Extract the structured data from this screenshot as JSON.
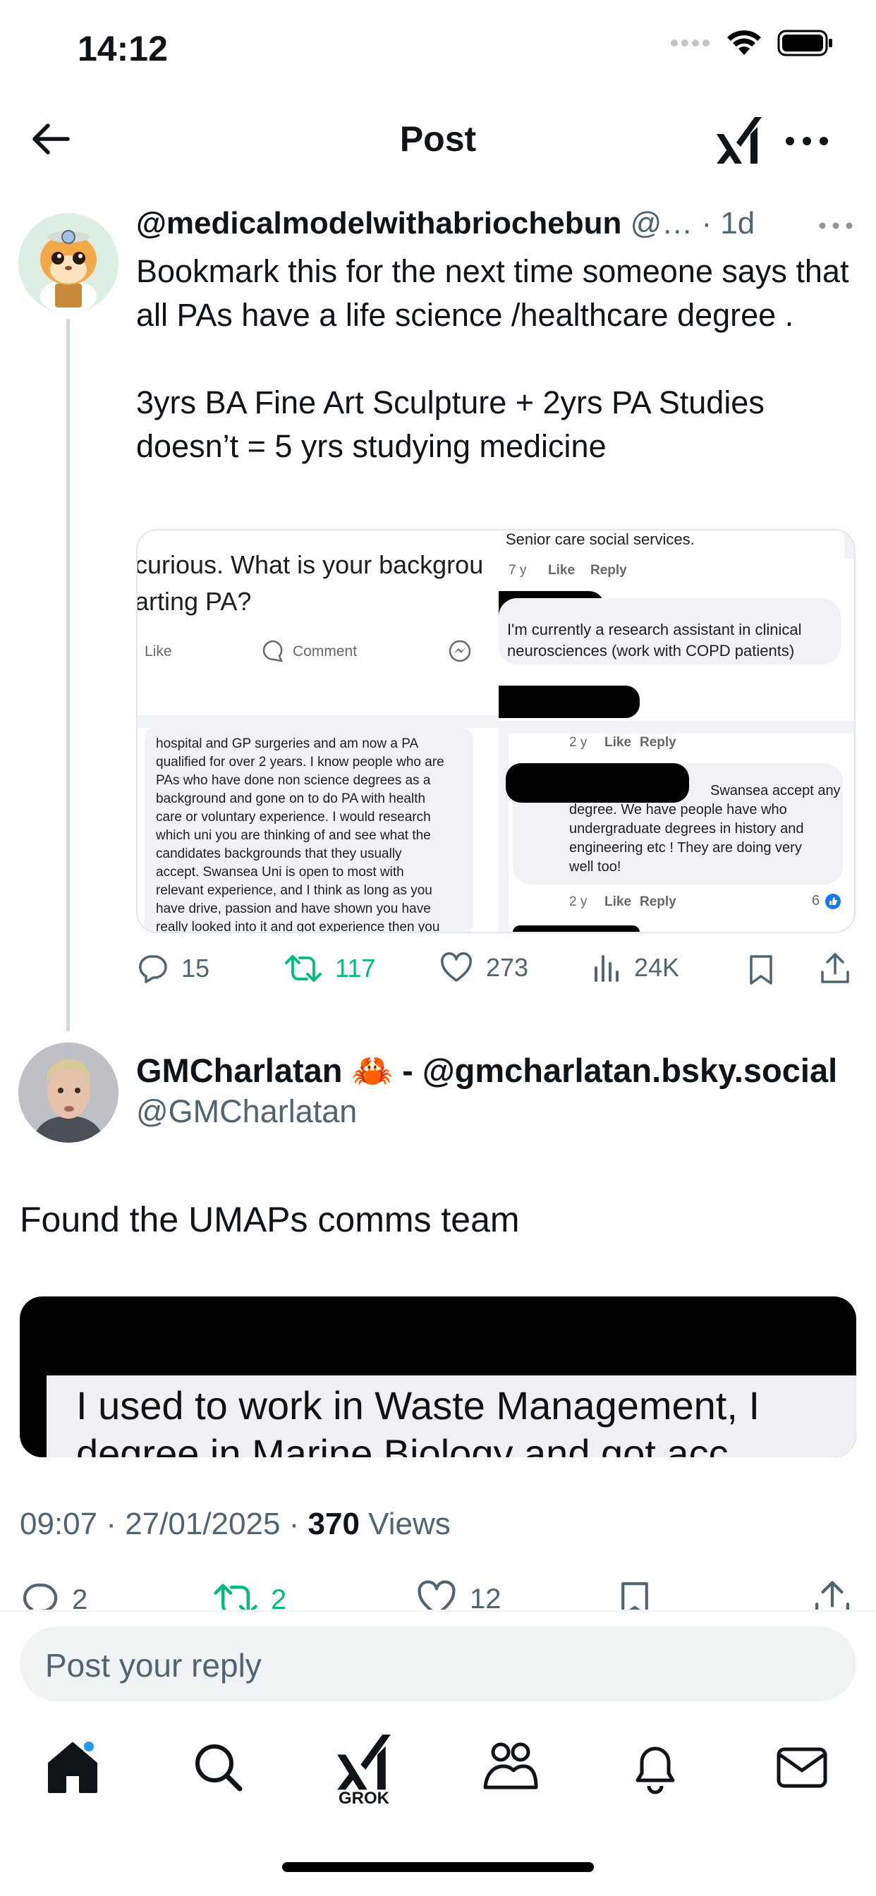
{
  "status_bar": {
    "time": "14:12"
  },
  "header": {
    "title": "Post"
  },
  "post1": {
    "display_name": "@medicalmodelwithabriochebun",
    "meta": " @… · 1d",
    "text_line1": "Bookmark this for the next time someone says that all PAs have a life science /healthcare degree .",
    "text_line2": "3yrs BA Fine Art Sculpture + 2yrs PA Studies doesn’t = 5 yrs studying medicine",
    "media": {
      "left_question": "curious. What is your backgrou",
      "left_question2": "arting PA?",
      "like": "Like",
      "comment": "Comment",
      "left_body": [
        "hospital and GP surgeries and am now a PA",
        "qualified for over 2 years. I know people who are",
        "PAs who have done non science degrees as a",
        "background and gone on to do PA with health",
        "care or voluntary experience. I would research",
        "which uni you are thinking of and see what the",
        "candidates backgrounds that they usually",
        "accept. Swansea Uni is open to most with",
        "relevant experience, and I think as long as you",
        "have drive, passion and have shown you have",
        "really looked into it and got experience then you"
      ],
      "right_top": "Senior care social services.",
      "right_age1": "7 y",
      "right_like": "Like",
      "right_reply": "Reply",
      "right_c2_1": "I'm currently a research assistant in clinical",
      "right_c2_2": "neurosciences (work with COPD patients)",
      "right_age2": "2 y",
      "right_c3": [
        "Swansea accept any",
        "degree. We have people have who",
        "undergraduate degrees in history and",
        "engineering etc ! They are doing very",
        "well too!"
      ],
      "right_reactions": "6"
    },
    "actions": {
      "replies": "15",
      "reposts": "117",
      "likes": "273",
      "views": "24K"
    }
  },
  "post2": {
    "display_name": "GMCharlatan 🦀 - @gmcharlatan.bsky.social",
    "handle": "@GMCharlatan",
    "text": "Found the UMAPs comms team",
    "media_text": "I used to work in Waste Management, I",
    "media_text2": "degree in Marine Biology and got acc",
    "time": "09:07 · 27/01/2025 · ",
    "views_count": "370",
    "views_label": " Views",
    "actions": {
      "replies": "2",
      "reposts": "2",
      "likes": "12"
    }
  },
  "reply": {
    "placeholder": "Post your reply"
  },
  "tabbar": {
    "grok_label": "GROK"
  },
  "colors": {
    "accent": "#1d9bf0",
    "repost_green": "#00ba7c",
    "muted": "#536471"
  },
  "icons": [
    "back-arrow-icon",
    "grok-icon",
    "more-icon",
    "reply-icon",
    "repost-icon",
    "like-icon",
    "views-icon",
    "bookmark-icon",
    "share-icon",
    "home-icon",
    "search-icon",
    "communities-icon",
    "notifications-icon",
    "messages-icon"
  ]
}
